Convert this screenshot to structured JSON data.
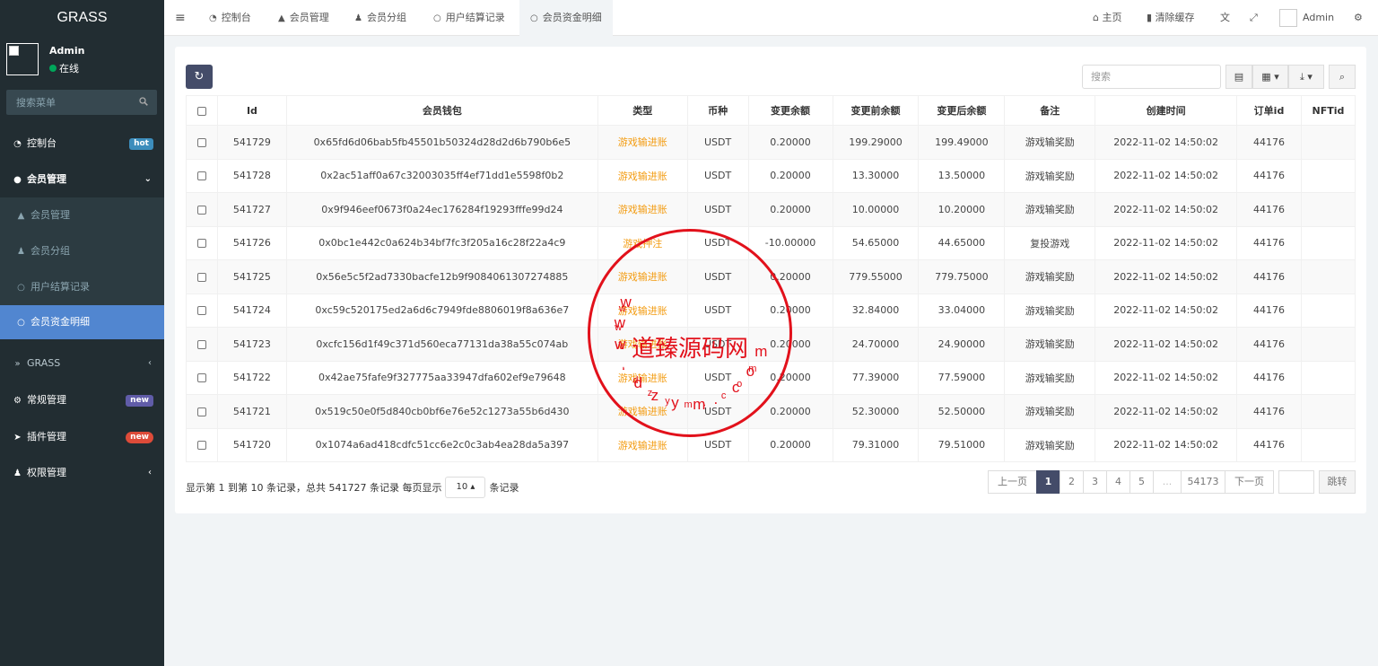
{
  "app": {
    "logo": "GRASS"
  },
  "user": {
    "name": "Admin",
    "status": "在线"
  },
  "sidebar": {
    "search_placeholder": "搜索菜单",
    "items": [
      {
        "label": "控制台",
        "badge": "hot",
        "badge_color": "#3c8dbc"
      },
      {
        "label": "会员管理"
      },
      {
        "label": "会员管理"
      },
      {
        "label": "会员分组"
      },
      {
        "label": "用户结算记录"
      },
      {
        "label": "会员资金明细"
      },
      {
        "label": "GRASS"
      },
      {
        "label": "常规管理",
        "badge": "new",
        "badge_color": "#605ca8"
      },
      {
        "label": "插件管理",
        "badge": "new",
        "badge_color": "#dd4b39"
      },
      {
        "label": "权限管理"
      }
    ]
  },
  "tabs": [
    {
      "label": "控制台"
    },
    {
      "label": "会员管理"
    },
    {
      "label": "会员分组"
    },
    {
      "label": "用户结算记录"
    },
    {
      "label": "会员资金明细"
    }
  ],
  "topnav": {
    "home": "主页",
    "clear_cache": "清除缓存",
    "admin": "Admin"
  },
  "toolbar": {
    "search_placeholder": "搜索"
  },
  "table": {
    "headers": [
      "Id",
      "会员钱包",
      "类型",
      "币种",
      "变更余额",
      "变更前余额",
      "变更后余额",
      "备注",
      "创建时间",
      "订单id",
      "NFTid"
    ],
    "rows": [
      [
        "541729",
        "0x65fd6d06bab5fb45501b50324d28d2d6b790b6e5",
        "游戏输进账",
        "USDT",
        "0.20000",
        "199.29000",
        "199.49000",
        "游戏输奖励",
        "2022-11-02 14:50:02",
        "44176",
        ""
      ],
      [
        "541728",
        "0x2ac51aff0a67c32003035ff4ef71dd1e5598f0b2",
        "游戏输进账",
        "USDT",
        "0.20000",
        "13.30000",
        "13.50000",
        "游戏输奖励",
        "2022-11-02 14:50:02",
        "44176",
        ""
      ],
      [
        "541727",
        "0x9f946eef0673f0a24ec176284f19293fffe99d24",
        "游戏输进账",
        "USDT",
        "0.20000",
        "10.00000",
        "10.20000",
        "游戏输奖励",
        "2022-11-02 14:50:02",
        "44176",
        ""
      ],
      [
        "541726",
        "0x0bc1e442c0a624b34bf7fc3f205a16c28f22a4c9",
        "游戏押注",
        "USDT",
        "-10.00000",
        "54.65000",
        "44.65000",
        "复投游戏",
        "2022-11-02 14:50:02",
        "44176",
        ""
      ],
      [
        "541725",
        "0x56e5c5f2ad7330bacfe12b9f9084061307274885",
        "游戏输进账",
        "USDT",
        "0.20000",
        "779.55000",
        "779.75000",
        "游戏输奖励",
        "2022-11-02 14:50:02",
        "44176",
        ""
      ],
      [
        "541724",
        "0xc59c520175ed2a6d6c7949fde8806019f8a636e7",
        "游戏输进账",
        "USDT",
        "0.20000",
        "32.84000",
        "33.04000",
        "游戏输奖励",
        "2022-11-02 14:50:02",
        "44176",
        ""
      ],
      [
        "541723",
        "0xcfc156d1f49c371d560eca77131da38a55c074ab",
        "游戏输进账",
        "USDT",
        "0.20000",
        "24.70000",
        "24.90000",
        "游戏输奖励",
        "2022-11-02 14:50:02",
        "44176",
        ""
      ],
      [
        "541722",
        "0x42ae75fafe9f327775aa33947dfa602ef9e79648",
        "游戏输进账",
        "USDT",
        "0.20000",
        "77.39000",
        "77.59000",
        "游戏输奖励",
        "2022-11-02 14:50:02",
        "44176",
        ""
      ],
      [
        "541721",
        "0x519c50e0f5d840cb0bf6e76e52c1273a55b6d430",
        "游戏输进账",
        "USDT",
        "0.20000",
        "52.30000",
        "52.50000",
        "游戏输奖励",
        "2022-11-02 14:50:02",
        "44176",
        ""
      ],
      [
        "541720",
        "0x1074a6ad418cdfc51cc6e2c0c3ab4ea28da5a397",
        "游戏输进账",
        "USDT",
        "0.20000",
        "79.31000",
        "79.51000",
        "游戏输奖励",
        "2022-11-02 14:50:02",
        "44176",
        ""
      ]
    ]
  },
  "footer": {
    "info": "显示第 1 到第 10 条记录，总共 541727 条记录 每页显示",
    "page_size": "10",
    "suffix": "条记录"
  },
  "pagination": {
    "prev": "上一页",
    "pages": [
      "1",
      "2",
      "3",
      "4",
      "5",
      "...",
      "54173"
    ],
    "next": "下一页",
    "jump": "跳转",
    "current": "1"
  },
  "watermark": {
    "center": "道臻源码网",
    "ring_top": "www.dzym.com",
    "ring_bottom": "www.dzym.com",
    "color": "#e2111b"
  },
  "colors": {
    "sidebar_bg": "#222d32",
    "active_menu": "#5186d0",
    "primary_btn": "#444c69",
    "type_text": "#f39c12"
  }
}
